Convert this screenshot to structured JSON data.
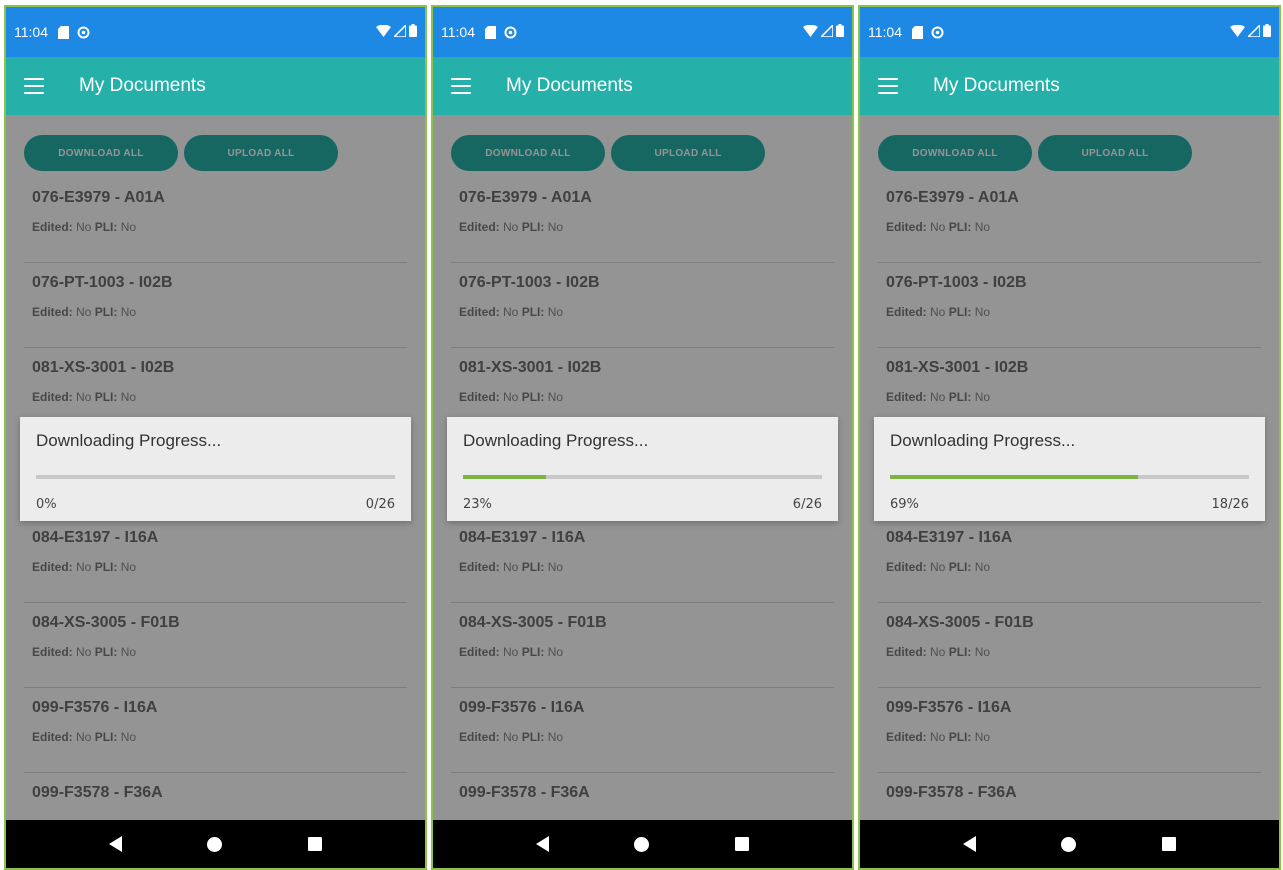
{
  "screens": [
    {
      "status": {
        "time": "11:04"
      },
      "app_bar": {
        "title": "My Documents"
      },
      "buttons": {
        "download_all": "DOWNLOAD ALL",
        "upload_all": "UPLOAD ALL"
      },
      "documents": [
        {
          "title": "076-E3979 - A01A",
          "edited_label": "Edited:",
          "edited": "No",
          "pli_label": "PLI:",
          "pli": "No"
        },
        {
          "title": "076-PT-1003 - I02B",
          "edited_label": "Edited:",
          "edited": "No",
          "pli_label": "PLI:",
          "pli": "No"
        },
        {
          "title": "081-XS-3001 - I02B",
          "edited_label": "Edited:",
          "edited": "No",
          "pli_label": "PLI:",
          "pli": "No"
        },
        {
          "title": "",
          "edited_label": "",
          "edited": "",
          "pli_label": "",
          "pli": ""
        },
        {
          "title": "084-E3197 - I16A",
          "edited_label": "Edited:",
          "edited": "No",
          "pli_label": "PLI:",
          "pli": "No"
        },
        {
          "title": "084-XS-3005 - F01B",
          "edited_label": "Edited:",
          "edited": "No",
          "pli_label": "PLI:",
          "pli": "No"
        },
        {
          "title": "099-F3576 - I16A",
          "edited_label": "Edited:",
          "edited": "No",
          "pli_label": "PLI:",
          "pli": "No"
        },
        {
          "title": "099-F3578 - F36A",
          "edited_label": "",
          "edited": "",
          "pli_label": "",
          "pli": ""
        }
      ],
      "dialog": {
        "title": "Downloading Progress...",
        "percent_text": "0%",
        "count_text": "0/26",
        "progress_fraction": 0.0
      }
    },
    {
      "status": {
        "time": "11:04"
      },
      "app_bar": {
        "title": "My Documents"
      },
      "buttons": {
        "download_all": "DOWNLOAD ALL",
        "upload_all": "UPLOAD ALL"
      },
      "documents": [
        {
          "title": "076-E3979 - A01A",
          "edited_label": "Edited:",
          "edited": "No",
          "pli_label": "PLI:",
          "pli": "No"
        },
        {
          "title": "076-PT-1003 - I02B",
          "edited_label": "Edited:",
          "edited": "No",
          "pli_label": "PLI:",
          "pli": "No"
        },
        {
          "title": "081-XS-3001 - I02B",
          "edited_label": "Edited:",
          "edited": "No",
          "pli_label": "PLI:",
          "pli": "No"
        },
        {
          "title": "",
          "edited_label": "",
          "edited": "",
          "pli_label": "",
          "pli": ""
        },
        {
          "title": "084-E3197 - I16A",
          "edited_label": "Edited:",
          "edited": "No",
          "pli_label": "PLI:",
          "pli": "No"
        },
        {
          "title": "084-XS-3005 - F01B",
          "edited_label": "Edited:",
          "edited": "No",
          "pli_label": "PLI:",
          "pli": "No"
        },
        {
          "title": "099-F3576 - I16A",
          "edited_label": "Edited:",
          "edited": "No",
          "pli_label": "PLI:",
          "pli": "No"
        },
        {
          "title": "099-F3578 - F36A",
          "edited_label": "",
          "edited": "",
          "pli_label": "",
          "pli": ""
        }
      ],
      "dialog": {
        "title": "Downloading Progress...",
        "percent_text": "23%",
        "count_text": "6/26",
        "progress_fraction": 0.23
      }
    },
    {
      "status": {
        "time": "11:04"
      },
      "app_bar": {
        "title": "My Documents"
      },
      "buttons": {
        "download_all": "DOWNLOAD ALL",
        "upload_all": "UPLOAD ALL"
      },
      "documents": [
        {
          "title": "076-E3979 - A01A",
          "edited_label": "Edited:",
          "edited": "No",
          "pli_label": "PLI:",
          "pli": "No"
        },
        {
          "title": "076-PT-1003 - I02B",
          "edited_label": "Edited:",
          "edited": "No",
          "pli_label": "PLI:",
          "pli": "No"
        },
        {
          "title": "081-XS-3001 - I02B",
          "edited_label": "Edited:",
          "edited": "No",
          "pli_label": "PLI:",
          "pli": "No"
        },
        {
          "title": "",
          "edited_label": "",
          "edited": "",
          "pli_label": "",
          "pli": ""
        },
        {
          "title": "084-E3197 - I16A",
          "edited_label": "Edited:",
          "edited": "No",
          "pli_label": "PLI:",
          "pli": "No"
        },
        {
          "title": "084-XS-3005 - F01B",
          "edited_label": "Edited:",
          "edited": "No",
          "pli_label": "PLI:",
          "pli": "No"
        },
        {
          "title": "099-F3576 - I16A",
          "edited_label": "Edited:",
          "edited": "No",
          "pli_label": "PLI:",
          "pli": "No"
        },
        {
          "title": "099-F3578 - F36A",
          "edited_label": "",
          "edited": "",
          "pli_label": "",
          "pli": ""
        }
      ],
      "dialog": {
        "title": "Downloading Progress...",
        "percent_text": "69%",
        "count_text": "18/26",
        "progress_fraction": 0.69
      }
    }
  ],
  "colors": {
    "status_bar": "#1e88e5",
    "app_bar": "#26b0aa",
    "progress": "#7cb342",
    "frame": "#8bc34a"
  }
}
